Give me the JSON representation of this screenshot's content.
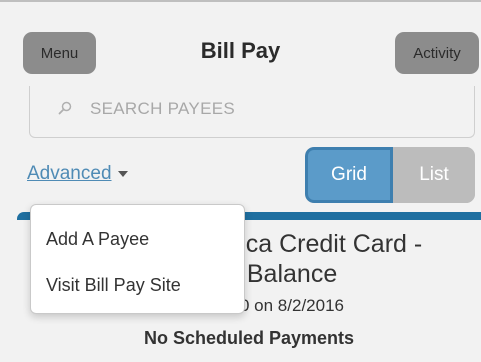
{
  "header": {
    "menu_label": "Menu",
    "title": "Bill Pay",
    "activity_label": "Activity"
  },
  "search": {
    "placeholder": "SEARCH PAYEES"
  },
  "filters": {
    "advanced_label": "Advanced ",
    "view_options": [
      "Grid",
      "List"
    ],
    "selected_view": "Grid"
  },
  "dropdown": {
    "items": [
      "Add A Payee",
      "Visit Bill Pay Site"
    ]
  },
  "payee_card": {
    "title_line1": "ca Credit Card -",
    "title_line2": "- 0 Balance",
    "last_payment": "0 on 8/2/2016",
    "status": "No Scheduled Payments"
  },
  "colors": {
    "accent": "#5b9bc9",
    "card_bar": "#1f6fa0",
    "link": "#4f8bb5",
    "header_button": "#8c8c8c"
  }
}
